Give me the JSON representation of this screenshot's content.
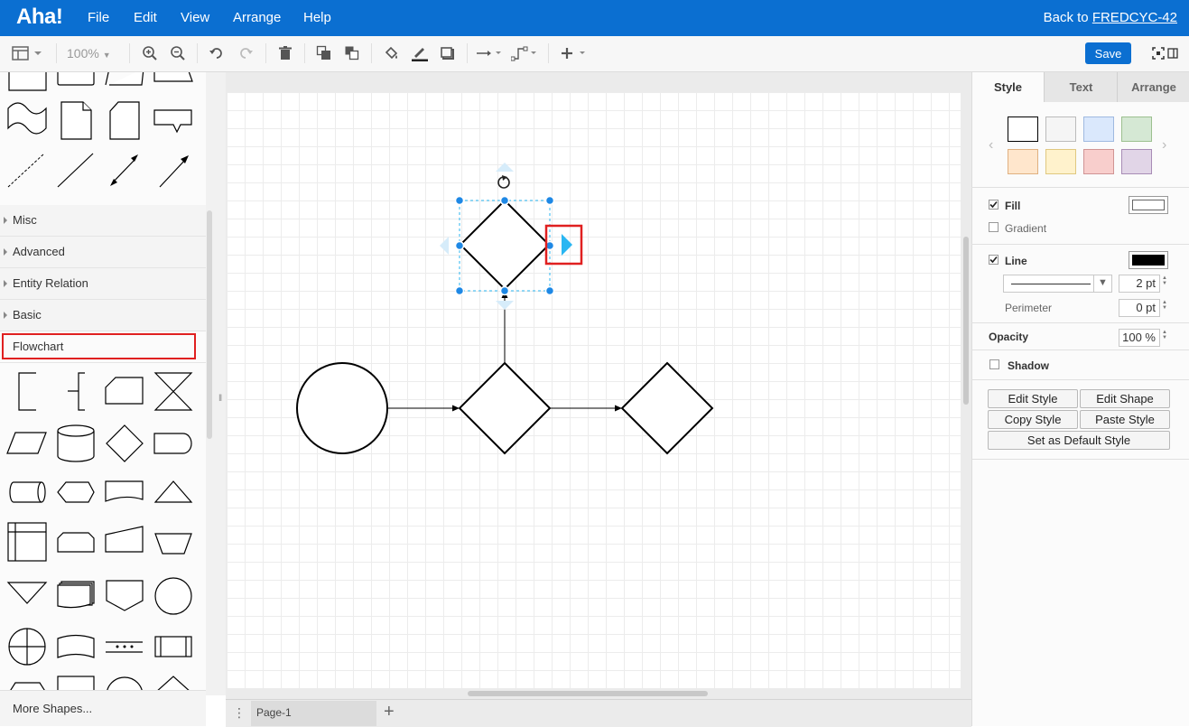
{
  "app": {
    "logo": "Aha!",
    "menu": [
      "File",
      "Edit",
      "View",
      "Arrange",
      "Help"
    ],
    "back_prefix": "Back to ",
    "back_link": "FREDCYC-42"
  },
  "toolbar": {
    "zoom": "100%",
    "save_label": "Save"
  },
  "left_panel": {
    "categories": [
      "Misc",
      "Advanced",
      "Entity Relation",
      "Basic",
      "Flowchart"
    ],
    "selected_category": "Flowchart",
    "more_shapes": "More Shapes..."
  },
  "page_tabs": {
    "current_page": "Page-1"
  },
  "format_panel": {
    "tabs": [
      "Style",
      "Text",
      "Arrange"
    ],
    "active_tab": "Style",
    "swatch_colors": [
      "#ffffff",
      "#f5f5f5",
      "#dae8fc",
      "#d5e8d4",
      "#ffe6cc",
      "#fff2cc",
      "#f8cecc",
      "#e1d5e7"
    ],
    "fill_label": "Fill",
    "fill_checked": true,
    "fill_color": "#ffffff",
    "gradient_label": "Gradient",
    "gradient_checked": false,
    "line_label": "Line",
    "line_checked": true,
    "line_color": "#000000",
    "line_width": "2 pt",
    "perimeter_label": "Perimeter",
    "perimeter_value": "0 pt",
    "opacity_label": "Opacity",
    "opacity_value": "100 %",
    "shadow_label": "Shadow",
    "shadow_checked": false,
    "buttons": {
      "edit_style": "Edit Style",
      "edit_shape": "Edit Shape",
      "copy_style": "Copy Style",
      "paste_style": "Paste Style",
      "set_default": "Set as Default Style"
    }
  },
  "colors": {
    "brand": "#0b6fd1",
    "selection": "#29b6f2",
    "highlight": "#e02020"
  }
}
